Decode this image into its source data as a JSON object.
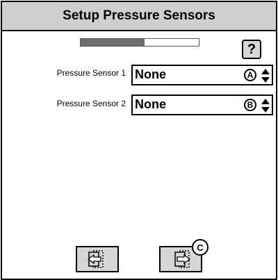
{
  "title": "Setup Pressure Sensors",
  "progress": {
    "fraction": 0.54
  },
  "help": {
    "label": "?",
    "icon": "help-icon"
  },
  "sensors": [
    {
      "label": "Pressure Sensor 1",
      "value": "None",
      "callout": "A"
    },
    {
      "label": "Pressure Sensor 2",
      "value": "None",
      "callout": "B"
    }
  ],
  "nav": {
    "back_icon": "back-arrow-icon",
    "next_icon": "next-arrow-icon",
    "next_callout": "C"
  },
  "colors": {
    "title_bar": "#cfcfcf",
    "progress_fill": "#6e6e6e",
    "button_face": "#d6d6d6"
  }
}
